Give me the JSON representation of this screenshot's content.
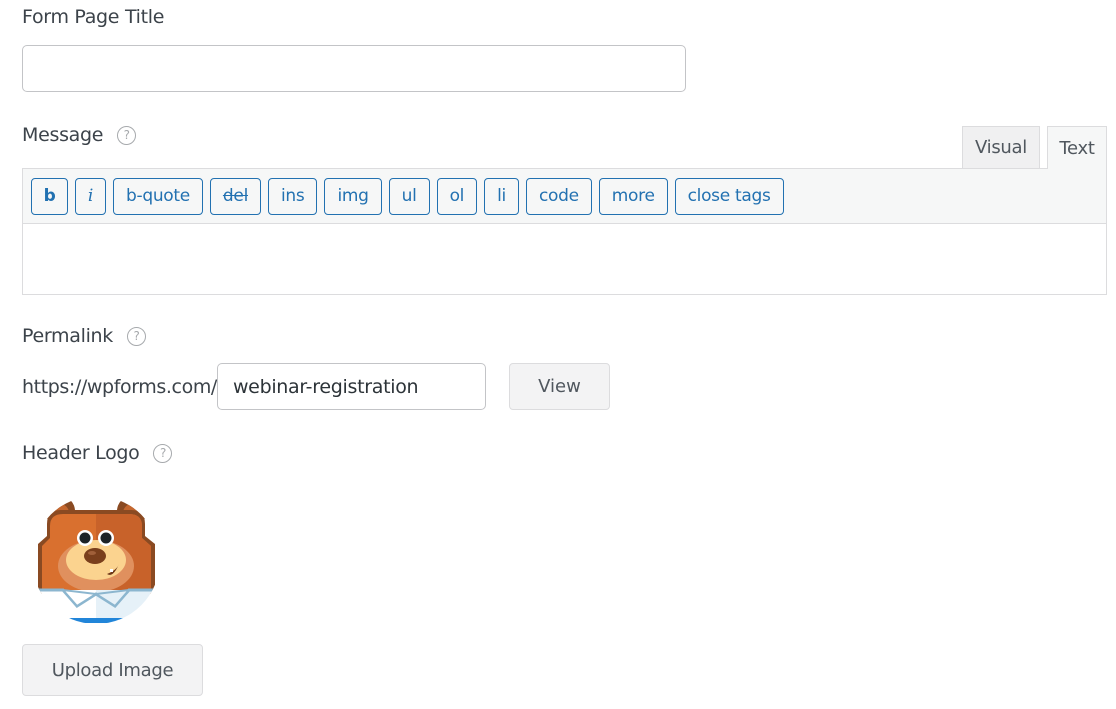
{
  "form_page_title": {
    "label": "Form Page Title",
    "value": "",
    "placeholder": ""
  },
  "message": {
    "label": "Message",
    "help_icon": "question-circle-icon",
    "tabs": [
      {
        "label": "Visual",
        "active": false
      },
      {
        "label": "Text",
        "active": true
      }
    ],
    "toolbar_buttons": [
      {
        "label": "b",
        "name": "bold"
      },
      {
        "label": "i",
        "name": "italic"
      },
      {
        "label": "b-quote",
        "name": "blockquote"
      },
      {
        "label": "del",
        "name": "delete"
      },
      {
        "label": "ins",
        "name": "insert"
      },
      {
        "label": "img",
        "name": "image"
      },
      {
        "label": "ul",
        "name": "unordered-list"
      },
      {
        "label": "ol",
        "name": "ordered-list"
      },
      {
        "label": "li",
        "name": "list-item"
      },
      {
        "label": "code",
        "name": "code"
      },
      {
        "label": "more",
        "name": "more"
      },
      {
        "label": "close tags",
        "name": "close-tags"
      }
    ],
    "content": ""
  },
  "permalink": {
    "label": "Permalink",
    "help_icon": "question-circle-icon",
    "prefix": "https://wpforms.com/",
    "slug": "webinar-registration",
    "view_label": "View"
  },
  "header_logo": {
    "label": "Header Logo",
    "help_icon": "question-circle-icon",
    "image": "wpforms-bear-mascot",
    "upload_label": "Upload Image"
  },
  "colors": {
    "accent": "#2271b1",
    "text": "#3c434a",
    "border": "#dcdcde",
    "toolbar_bg": "#f6f7f7"
  }
}
